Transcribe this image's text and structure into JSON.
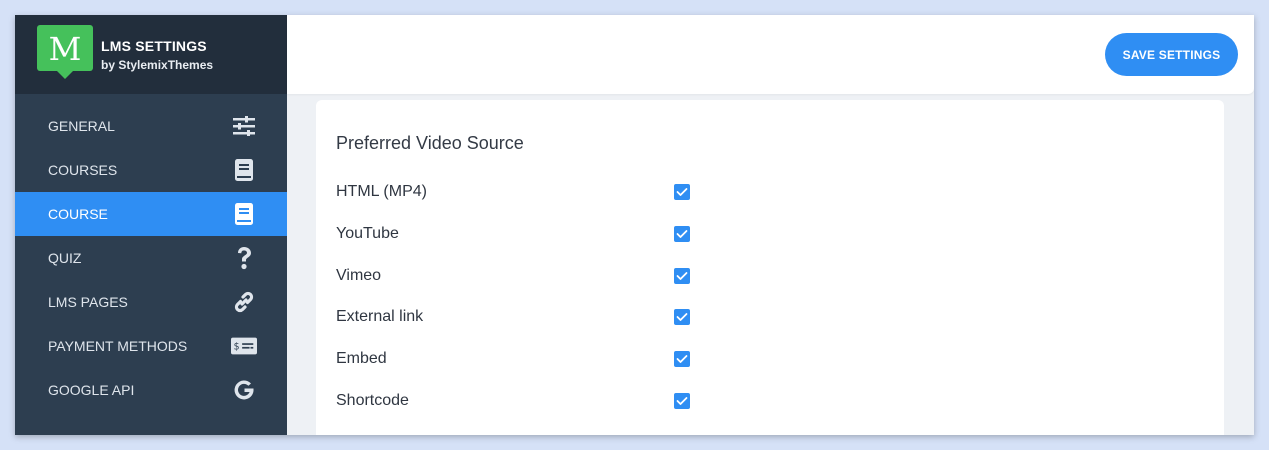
{
  "brand": {
    "logo_letter": "M",
    "title": "LMS SETTINGS",
    "subtitle": "by StylemixThemes",
    "logo_color": "#45c15b"
  },
  "header": {
    "save_label": "SAVE SETTINGS"
  },
  "sidebar": {
    "items": [
      {
        "label": "GENERAL",
        "icon": "sliders-icon",
        "active": false
      },
      {
        "label": "COURSES",
        "icon": "book-icon",
        "active": false
      },
      {
        "label": "COURSE",
        "icon": "book-open-icon",
        "active": true
      },
      {
        "label": "QUIZ",
        "icon": "question-icon",
        "active": false
      },
      {
        "label": "LMS PAGES",
        "icon": "link-icon",
        "active": false
      },
      {
        "label": "PAYMENT METHODS",
        "icon": "money-check-icon",
        "active": false
      },
      {
        "label": "GOOGLE API",
        "icon": "google-icon",
        "active": false
      }
    ]
  },
  "main": {
    "section_title": "Preferred Video Source",
    "options": [
      {
        "label": "HTML (MP4)",
        "checked": true
      },
      {
        "label": "YouTube",
        "checked": true
      },
      {
        "label": "Vimeo",
        "checked": true
      },
      {
        "label": "External link",
        "checked": true
      },
      {
        "label": "Embed",
        "checked": true
      },
      {
        "label": "Shortcode",
        "checked": true
      }
    ]
  },
  "colors": {
    "accent": "#2f8ef3",
    "sidebar_bg": "#2d3e50",
    "brand_bg": "#222e3c",
    "page_bg": "#d5e1f7"
  }
}
